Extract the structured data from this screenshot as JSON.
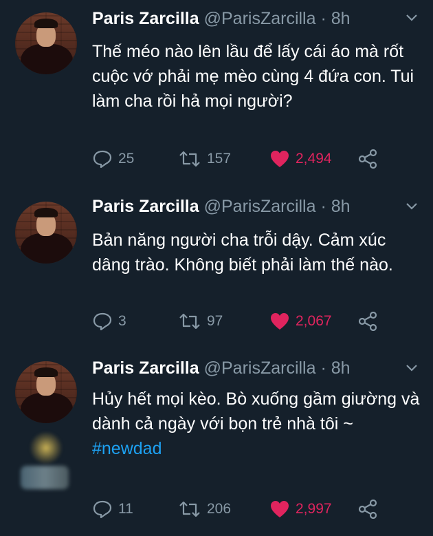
{
  "tweets": [
    {
      "name": "Paris Zarcilla",
      "handle": "@ParisZarcilla",
      "sep": "·",
      "time": "8h",
      "text": "Thế méo nào lên lầu để lấy cái áo mà rốt cuộc vớ phải mẹ mèo cùng 4 đứa con. Tui làm cha rồi hả mọi người?",
      "hashtag": "",
      "replies": "25",
      "retweets": "157",
      "likes": "2,494"
    },
    {
      "name": "Paris Zarcilla",
      "handle": "@ParisZarcilla",
      "sep": "·",
      "time": "8h",
      "text": "Bản năng người cha trỗi dậy. Cảm xúc dâng trào. Không biết phải làm thế nào.",
      "hashtag": "",
      "replies": "3",
      "retweets": "97",
      "likes": "2,067"
    },
    {
      "name": "Paris Zarcilla",
      "handle": "@ParisZarcilla",
      "sep": "·",
      "time": "8h",
      "text": "Hủy hết mọi kèo. Bò xuống gầm giường và dành cả ngày với bọn trẻ nhà tôi ~",
      "hashtag": "#newdad",
      "replies": "11",
      "retweets": "206",
      "likes": "2,997"
    }
  ],
  "colors": {
    "background": "#15202b",
    "text": "#ffffff",
    "muted": "#8899a6",
    "like": "#e0245e",
    "link": "#1da1f2"
  },
  "icons": [
    "avatar",
    "chevron-down-icon",
    "reply-icon",
    "retweet-icon",
    "heart-icon",
    "share-icon"
  ]
}
